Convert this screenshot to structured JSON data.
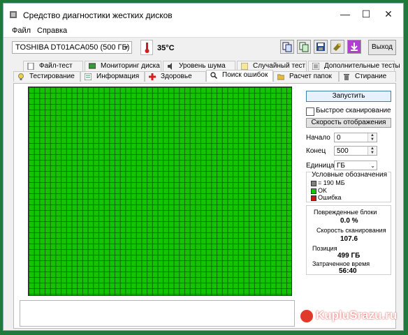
{
  "window": {
    "title": "Средство диагностики жестких дисков"
  },
  "menu": [
    "Файл",
    "Справка"
  ],
  "toolbar": {
    "drive": "TOSHIBA DT01ACA050 (500 ГБ)",
    "temperature": "35°C",
    "exit_label": "Выход"
  },
  "tabs_row1": [
    "Файл-тест",
    "Мониторинг диска",
    "Уровень шума",
    "Случайный тест",
    "Дополнительные тесты"
  ],
  "tabs_row2": [
    "Тестирование",
    "Информация",
    "Здоровье",
    "Поиск ошибок",
    "Расчет папок",
    "Стирание"
  ],
  "active_tab": "Поиск ошибок",
  "controls": {
    "start_label": "Запустить",
    "quick_scan_label": "Быстрое сканирование",
    "quick_scan_checked": false,
    "display_speed_label": "Скорость отображения",
    "start_label_text": "Начало",
    "start_value": "0",
    "end_label": "Конец",
    "end_value": "500",
    "unit_label": "Единица",
    "unit_value": "ГБ"
  },
  "legend": {
    "title": "Условные обозначения",
    "block": "= 190 МБ",
    "ok": "OK",
    "error": "Ошибка"
  },
  "stats": {
    "damaged_label": "Поврежденные блоки",
    "damaged_value": "0.0 %",
    "speed_label": "Скорость сканирования",
    "speed_value": "107.6",
    "position_label": "Позиция",
    "position_value": "499 ГБ",
    "elapsed_label": "Затраченное время",
    "elapsed_value": "56:40"
  },
  "watermark": "KupluSrazu.ru",
  "colors": {
    "ok": "#13c400",
    "error": "#d01010",
    "block": "#808080",
    "accent": "#3c7fb1"
  }
}
